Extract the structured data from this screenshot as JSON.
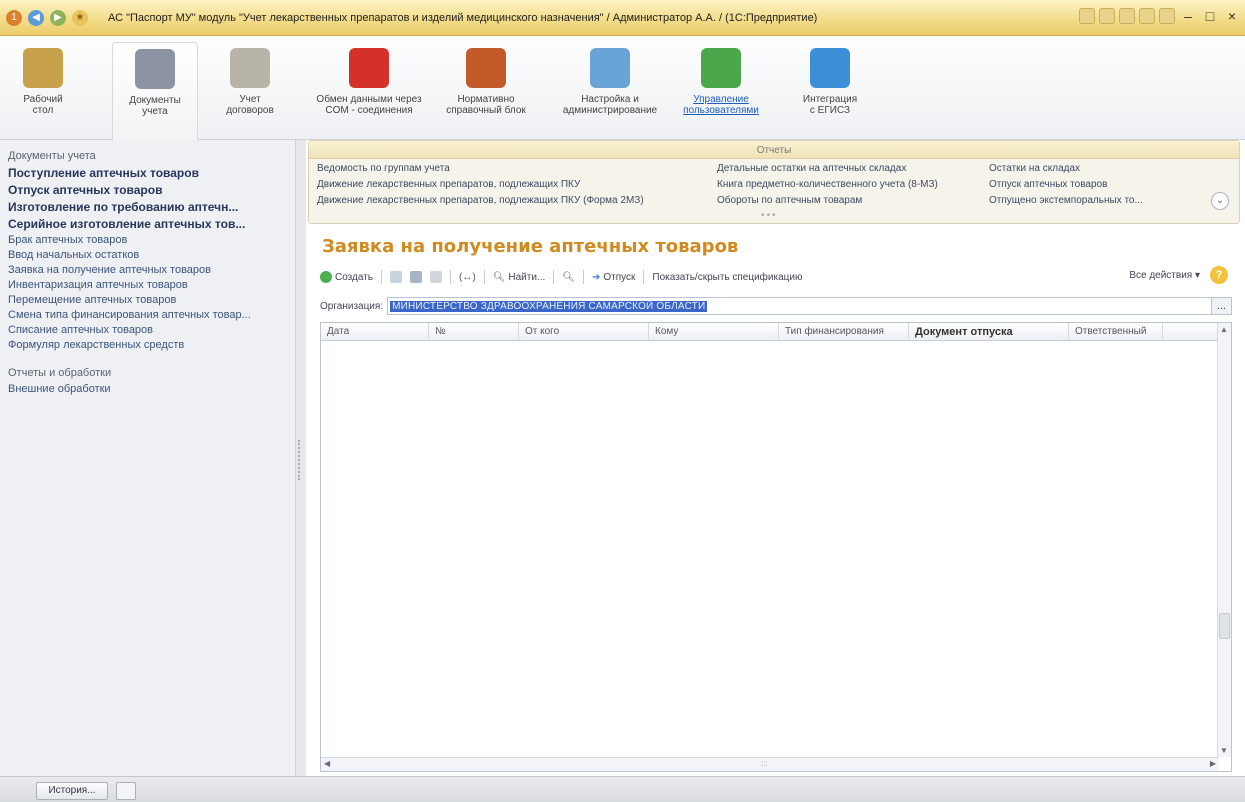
{
  "window": {
    "title": "АС \"Паспорт МУ\" модуль \"Учет лекарственных препаратов и изделий медицинского назначения\" / Администратор А.А. / (1С:Предприятие)"
  },
  "sections": [
    {
      "label": "Рабочий\nстол",
      "icon": "desktop-icon",
      "color": "#c7a24a"
    },
    {
      "label": "Документы\nучета",
      "icon": "documents-icon",
      "color": "#8c94a3"
    },
    {
      "label": "Учет\nдоговоров",
      "icon": "contracts-icon",
      "color": "#b8b4a8"
    },
    {
      "label": "Обмен данными через\nCOM - соединения",
      "icon": "exchange-icon",
      "color": "#d6302a"
    },
    {
      "label": "Нормативно\nсправочный блок",
      "icon": "books-icon",
      "color": "#c45a2a"
    },
    {
      "label": "Настройка и\nадминистрирование",
      "icon": "admin-icon",
      "color": "#6aa4d6"
    },
    {
      "label": "Управление\nпользователями",
      "icon": "users-icon",
      "color": "#4aa84a",
      "link": true
    },
    {
      "label": "Интеграция\nс ЕГИСЗ",
      "icon": "globe-icon",
      "color": "#3a8fd6"
    }
  ],
  "sidebar": {
    "head": "Документы учета",
    "items": [
      {
        "label": "Поступление аптечных товаров",
        "bold": true
      },
      {
        "label": "Отпуск аптечных товаров",
        "bold": true
      },
      {
        "label": "Изготовление по требованию аптечн...",
        "bold": true
      },
      {
        "label": "Серийное изготовление аптечных тов...",
        "bold": true
      },
      {
        "label": "Брак аптечных товаров",
        "bold": false
      },
      {
        "label": "Ввод начальных остатков",
        "bold": false
      },
      {
        "label": "Заявка на получение аптечных товаров",
        "bold": false
      },
      {
        "label": "Инвентаризация аптечных товаров",
        "bold": false
      },
      {
        "label": "Перемещение аптечных товаров",
        "bold": false
      },
      {
        "label": "Смена типа финансирования аптечных товар...",
        "bold": false
      },
      {
        "label": "Списание аптечных товаров",
        "bold": false
      },
      {
        "label": "Формуляр лекарственных средств",
        "bold": false
      }
    ],
    "group2_head": "Отчеты и обработки",
    "group2_items": [
      "Внешние обработки"
    ]
  },
  "reports": {
    "title": "Отчеты",
    "col1": [
      "Ведомость по группам учета",
      "Движение лекарственных препаратов, подлежащих ПКУ",
      "Движение лекарственных препаратов, подлежащих ПКУ (Форма 2МЗ)"
    ],
    "col2": [
      "Детальные остатки на аптечных складах",
      "Книга предметно-количественного учета (8-МЗ)",
      "Обороты по аптечным товарам"
    ],
    "col3": [
      "Остатки на складах",
      "Отпуск аптечных товаров",
      "Отпущено экстемпоральных то..."
    ]
  },
  "form": {
    "title": "Заявка на получение аптечных товаров",
    "toolbar": {
      "create": "Создать",
      "find": "Найти...",
      "release": "Отпуск",
      "toggle_spec": "Показать/скрыть спецификацию",
      "all_actions": "Все действия ▾"
    },
    "org_label": "Организация:",
    "org_value": "МИНИСТЕРСТВО ЗДРАВООХРАНЕНИЯ САМАРСКОЙ ОБЛАСТИ",
    "columns": [
      "Дата",
      "№",
      "От кого",
      "Кому",
      "Тип финансирования",
      "Документ отпуска",
      "Ответственный"
    ]
  },
  "status": {
    "history": "История..."
  }
}
